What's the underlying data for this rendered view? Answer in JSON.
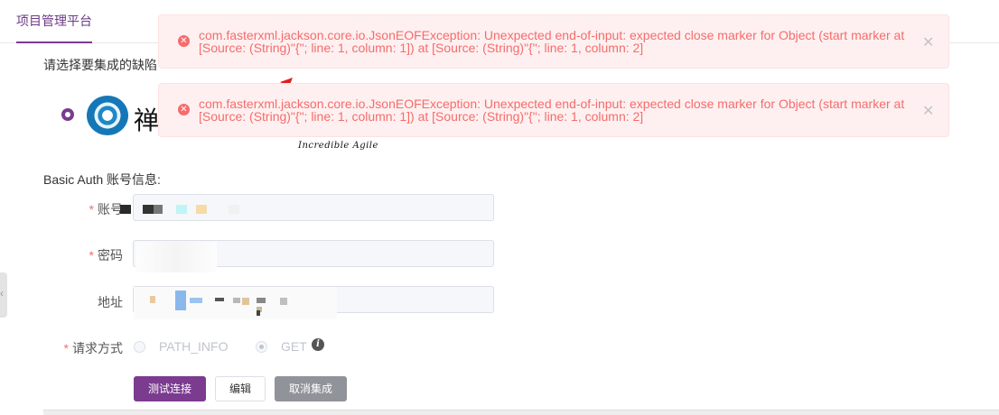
{
  "tabs": [
    {
      "label": "项目管理平台"
    }
  ],
  "page": {
    "select_prompt": "请选择要集成的缺陷",
    "logo_char": "禅",
    "slogan": "Incredible Agile"
  },
  "auth": {
    "section_title": "Basic Auth 账号信息:",
    "account_label": "账号",
    "password_label": "密码",
    "address_label": "地址",
    "request_method_label": "请求方式",
    "method_options": [
      "PATH_INFO",
      "GET"
    ],
    "selected_method": "GET"
  },
  "buttons": {
    "test_connection": "测试连接",
    "edit": "编辑",
    "cancel_integration": "取消集成"
  },
  "notifications": [
    {
      "message": "com.fasterxml.jackson.core.io.JsonEOFException: Unexpected end-of-input: expected close marker for Object (start marker at [Source: (String)\"{\"; line: 1, column: 1]) at [Source: (String)\"{\"; line: 1, column: 2]"
    },
    {
      "message": "com.fasterxml.jackson.core.io.JsonEOFException: Unexpected end-of-input: expected close marker for Object (start marker at [Source: (String)\"{\"; line: 1, column: 1]) at [Source: (String)\"{\"; line: 1, column: 2]"
    }
  ],
  "icons": {
    "error": "error-circle-icon",
    "close": "close-icon",
    "info": "info-icon",
    "collapse": "chevron-left-icon"
  },
  "colors": {
    "brand": "#7b3b8f",
    "error_text": "#f56c6c",
    "error_bg": "#fef0f0",
    "muted_button": "#909399"
  }
}
